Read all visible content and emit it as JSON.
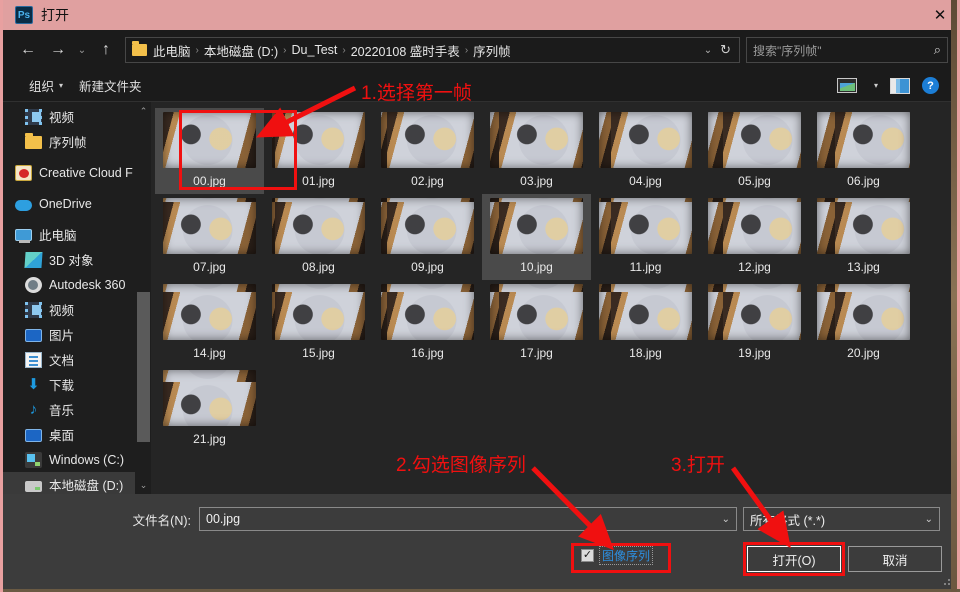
{
  "window": {
    "app_icon": "photoshop-icon",
    "app_icon_text": "Ps",
    "title": "打开",
    "close_label": "✕"
  },
  "nav": {
    "back_icon": "←",
    "forward_icon": "→",
    "recent_icon": "⌄",
    "up_icon": "↑",
    "breadcrumbs": [
      "此电脑",
      "本地磁盘 (D:)",
      "Du_Test",
      "20220108 盛时手表",
      "序列帧"
    ],
    "separator": "›",
    "dropdown_icon": "⌄",
    "refresh_icon": "↻"
  },
  "search": {
    "placeholder": "搜索\"序列帧\"",
    "icon": "⌕"
  },
  "toolbar": {
    "organize_label": "组织",
    "organize_caret": "▾",
    "new_folder_label": "新建文件夹",
    "view_caret": "▾",
    "help_label": "?"
  },
  "sidebar": {
    "scroll_up_icon": "⌃",
    "scroll_down_icon": "⌄",
    "items": [
      {
        "label": "视频",
        "icon": "video-icon",
        "icon_class": "i-video",
        "indent": true,
        "selected": false
      },
      {
        "label": "序列帧",
        "icon": "folder-icon",
        "icon_class": "i-folder",
        "indent": true,
        "selected": false
      },
      {
        "label": "Creative Cloud F",
        "icon": "creative-cloud-icon",
        "icon_class": "i-cc",
        "indent": false,
        "selected": false
      },
      {
        "label": "OneDrive",
        "icon": "onedrive-icon",
        "icon_class": "i-onedrive",
        "indent": false,
        "selected": false
      },
      {
        "label": "此电脑",
        "icon": "this-pc-icon",
        "icon_class": "i-pc",
        "indent": false,
        "selected": false
      },
      {
        "label": "3D 对象",
        "icon": "3d-objects-icon",
        "icon_class": "i-3d",
        "indent": true,
        "selected": false
      },
      {
        "label": "Autodesk 360",
        "icon": "autodesk-icon",
        "icon_class": "i-auto",
        "indent": true,
        "selected": false
      },
      {
        "label": "视频",
        "icon": "video-icon",
        "icon_class": "i-video",
        "indent": true,
        "selected": false
      },
      {
        "label": "图片",
        "icon": "pictures-icon",
        "icon_class": "i-desktop",
        "indent": true,
        "selected": false
      },
      {
        "label": "文档",
        "icon": "documents-icon",
        "icon_class": "i-doc",
        "indent": true,
        "selected": false
      },
      {
        "label": "下载",
        "icon": "downloads-icon",
        "icon_class": "i-dl",
        "indent": true,
        "selected": false
      },
      {
        "label": "音乐",
        "icon": "music-icon",
        "icon_class": "i-music",
        "indent": true,
        "selected": false
      },
      {
        "label": "桌面",
        "icon": "desktop-icon",
        "icon_class": "i-desktop",
        "indent": true,
        "selected": false
      },
      {
        "label": "Windows (C:)",
        "icon": "windows-drive-icon",
        "icon_class": "i-win",
        "indent": true,
        "selected": false
      },
      {
        "label": "本地磁盘 (D:)",
        "icon": "local-disk-icon",
        "icon_class": "i-disk",
        "indent": true,
        "selected": true
      }
    ]
  },
  "files": [
    {
      "name": "00.jpg",
      "selected": true
    },
    {
      "name": "01.jpg",
      "selected": false
    },
    {
      "name": "02.jpg",
      "selected": false
    },
    {
      "name": "03.jpg",
      "selected": false
    },
    {
      "name": "04.jpg",
      "selected": false
    },
    {
      "name": "05.jpg",
      "selected": false
    },
    {
      "name": "06.jpg",
      "selected": false
    },
    {
      "name": "07.jpg",
      "selected": false
    },
    {
      "name": "08.jpg",
      "selected": false
    },
    {
      "name": "09.jpg",
      "selected": false
    },
    {
      "name": "10.jpg",
      "selected": true
    },
    {
      "name": "11.jpg",
      "selected": false
    },
    {
      "name": "12.jpg",
      "selected": false
    },
    {
      "name": "13.jpg",
      "selected": false
    },
    {
      "name": "14.jpg",
      "selected": false
    },
    {
      "name": "15.jpg",
      "selected": false
    },
    {
      "name": "16.jpg",
      "selected": false
    },
    {
      "name": "17.jpg",
      "selected": false
    },
    {
      "name": "18.jpg",
      "selected": false
    },
    {
      "name": "19.jpg",
      "selected": false
    },
    {
      "name": "20.jpg",
      "selected": false
    },
    {
      "name": "21.jpg",
      "selected": false
    }
  ],
  "bottom": {
    "filename_label": "文件名(N):",
    "filename_value": "00.jpg",
    "filename_chevron": "⌄",
    "filetype_value": "所有格式 (*.*)",
    "filetype_chevron": "⌄",
    "sequence_checkbox_label": "图像序列",
    "sequence_checkbox_checked": true,
    "checkmark": "✓",
    "open_button": "打开(O)",
    "cancel_button": "取消"
  },
  "annotations": [
    {
      "text": "1.选择第一帧"
    },
    {
      "text": "2.勾选图像序列"
    },
    {
      "text": "3.打开"
    }
  ],
  "colors": {
    "titlebar": "#e0a0a0",
    "annotation_red": "#f01010",
    "accent_blue": "#2d8fe0"
  }
}
